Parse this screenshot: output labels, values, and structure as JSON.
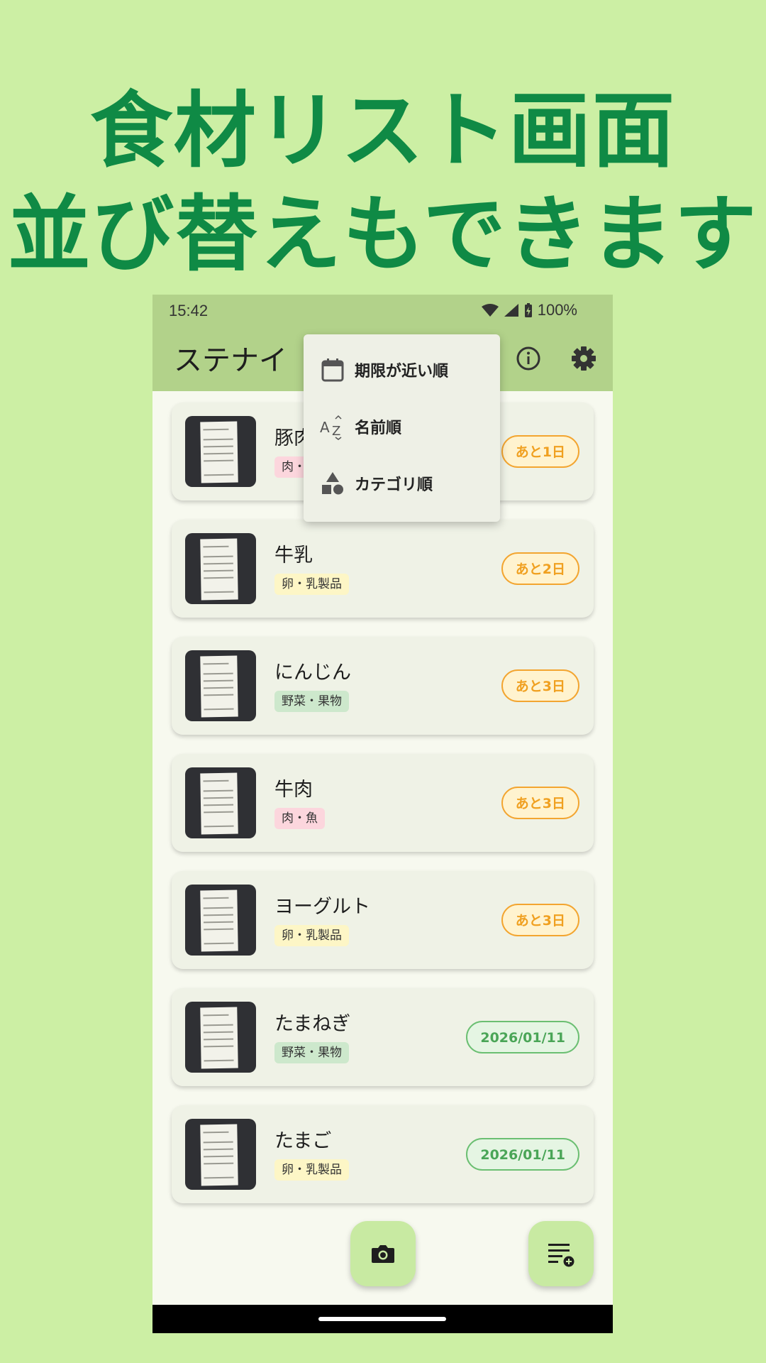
{
  "headline": {
    "line1": "食材リスト画面",
    "line2": "並び替えもできます"
  },
  "status_bar": {
    "time": "15:42",
    "battery": "100%"
  },
  "app_bar": {
    "title": "ステナイ",
    "icons": [
      "info-icon",
      "gear-icon"
    ]
  },
  "sort_menu": {
    "items": [
      {
        "label": "期限が近い順",
        "icon": "calendar-icon"
      },
      {
        "label": "名前順",
        "icon": "az-sort-icon"
      },
      {
        "label": "カテゴリ順",
        "icon": "shapes-icon"
      }
    ]
  },
  "items": [
    {
      "name": "豚肉",
      "category": "肉・魚",
      "expiry": "あと1日"
    },
    {
      "name": "牛乳",
      "category": "卵・乳製品",
      "expiry": "あと2日"
    },
    {
      "name": "にんじん",
      "category": "野菜・果物",
      "expiry": "あと3日"
    },
    {
      "name": "牛肉",
      "category": "肉・魚",
      "expiry": "あと3日"
    },
    {
      "name": "ヨーグルト",
      "category": "卵・乳製品",
      "expiry": "あと3日"
    },
    {
      "name": "たまねぎ",
      "category": "野菜・果物",
      "expiry": "2026/01/11"
    },
    {
      "name": "たまご",
      "category": "卵・乳製品",
      "expiry": "2026/01/11"
    }
  ],
  "colors": {
    "headline": "#0f8a45",
    "app_bar": "#b2d28a",
    "background": "#ccefa4",
    "soon_pill": "#f0a020",
    "date_pill": "#4aa557"
  },
  "fabs": [
    "camera-icon",
    "add-list-icon"
  ]
}
